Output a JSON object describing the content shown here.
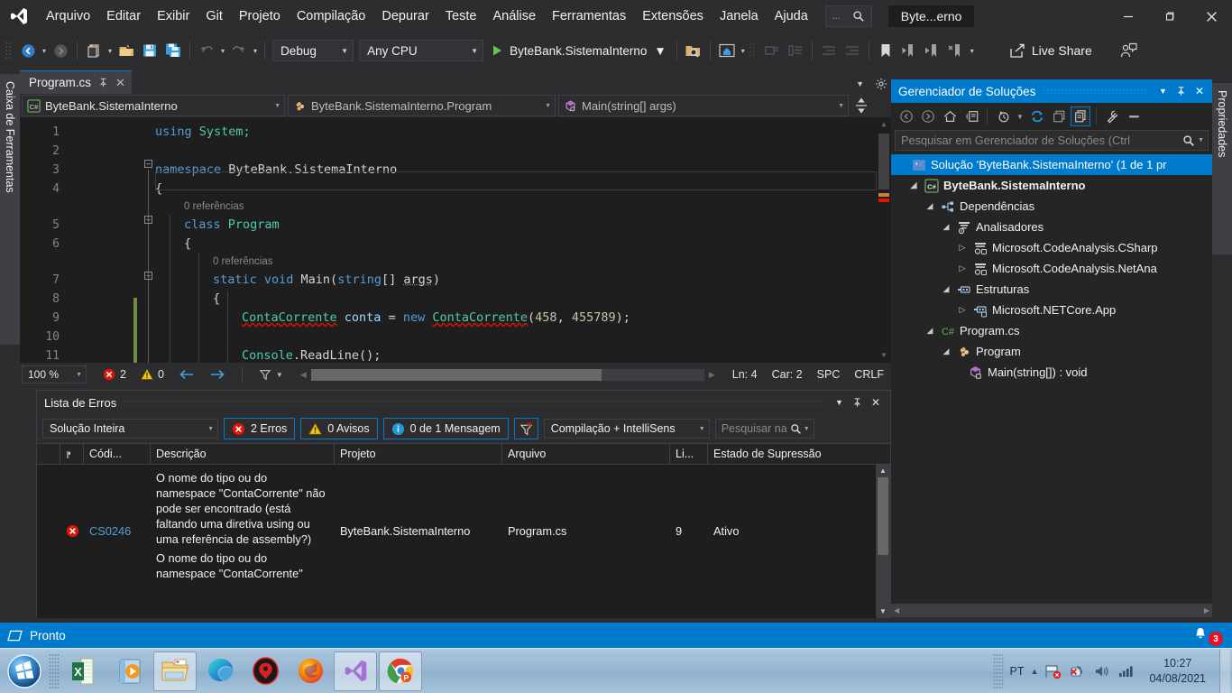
{
  "window": {
    "title": "Byte...erno",
    "app_icon": "visual-studio-logo",
    "controls": {
      "minimize": "—",
      "maximize": "❐",
      "close": "✕"
    }
  },
  "menubar": {
    "items": [
      "Arquivo",
      "Editar",
      "Exibir",
      "Git",
      "Projeto",
      "Compilação",
      "Depurar",
      "Teste",
      "Análise",
      "Ferramentas",
      "Extensões",
      "Janela",
      "Ajuda"
    ],
    "quick_launch": "..."
  },
  "toolbar": {
    "config_combo": "Debug",
    "platform_combo": "Any CPU",
    "run_label": "ByteBank.SistemaInterno",
    "live_share": "Live Share"
  },
  "docks": {
    "left_label": "Caixa de Ferramentas",
    "right_label": "Propriedades"
  },
  "editor": {
    "tab_title": "Program.cs",
    "nav": {
      "project": "ByteBank.SistemaInterno",
      "type": "ByteBank.SistemaInterno.Program",
      "member": "Main(string[] args)"
    },
    "line_numbers": [
      "1",
      "2",
      "3",
      "4",
      "5",
      "6",
      "7",
      "8",
      "9",
      "10",
      "11"
    ],
    "code_lines": [
      {
        "n": 1,
        "indent": 1,
        "tokens": [
          {
            "t": "using ",
            "c": "k"
          },
          {
            "t": "System;",
            "c": "t"
          }
        ]
      },
      {
        "n": 2,
        "indent": 0,
        "tokens": []
      },
      {
        "n": 3,
        "indent": 0,
        "tokens": [
          {
            "t": "namespace ",
            "c": "k"
          },
          {
            "t": "ByteBank.SistemaInterno",
            "c": "p"
          }
        ]
      },
      {
        "n": 4,
        "indent": 0,
        "tokens": [
          {
            "t": "{",
            "c": "p"
          }
        ]
      },
      {
        "n": 5,
        "indent": 2,
        "tokens": [
          {
            "t": "class ",
            "c": "k"
          },
          {
            "t": "Program",
            "c": "t"
          }
        ]
      },
      {
        "n": 6,
        "indent": 2,
        "tokens": [
          {
            "t": "{",
            "c": "p"
          }
        ]
      },
      {
        "n": 7,
        "indent": 3,
        "tokens": [
          {
            "t": "static ",
            "c": "k"
          },
          {
            "t": "void ",
            "c": "k"
          },
          {
            "t": "Main(",
            "c": "p"
          },
          {
            "t": "string",
            "c": "k"
          },
          {
            "t": "[] ",
            "c": "p"
          },
          {
            "t": "args",
            "c": "p"
          },
          {
            "t": ")",
            "c": "p"
          }
        ]
      },
      {
        "n": 8,
        "indent": 3,
        "tokens": [
          {
            "t": "{",
            "c": "p"
          }
        ]
      },
      {
        "n": 9,
        "indent": 4,
        "tokens": [
          {
            "t": "ContaCorrente",
            "c": "t squig"
          },
          {
            "t": " conta = ",
            "c": "p"
          },
          {
            "t": "new ",
            "c": "k"
          },
          {
            "t": "ContaCorrente",
            "c": "t squig"
          },
          {
            "t": "(",
            "c": "p"
          },
          {
            "t": "458",
            "c": "n"
          },
          {
            "t": ", ",
            "c": "p"
          },
          {
            "t": "455789",
            "c": "n"
          },
          {
            "t": ");",
            "c": "p"
          }
        ]
      },
      {
        "n": 10,
        "indent": 0,
        "tokens": []
      },
      {
        "n": 11,
        "indent": 4,
        "tokens": [
          {
            "t": "Console",
            "c": "t"
          },
          {
            "t": ".ReadLine();",
            "c": "p"
          }
        ]
      }
    ],
    "codelens": [
      {
        "text": "0 referências",
        "line": 5
      },
      {
        "text": "0 referências",
        "line": 7
      }
    ],
    "status": {
      "zoom": "100 %",
      "errors_count": "2",
      "warnings_count": "0",
      "line": "Ln: 4",
      "column": "Car: 2",
      "spaces": "SPC",
      "line_ending": "CRLF"
    }
  },
  "error_list": {
    "title": "Lista de Erros",
    "scope_combo": "Solução Inteira",
    "errors_button": "2 Erros",
    "warnings_button": "0 Avisos",
    "messages_button": "0 de 1 Mensagem",
    "build_combo": "Compilação + IntelliSens",
    "search_placeholder": "Pesquisar na",
    "columns": [
      "",
      "",
      "Códi...",
      "Descrição",
      "Projeto",
      "Arquivo",
      "Li...",
      "Estado de Supressão"
    ],
    "rows": [
      {
        "severity": "error",
        "code": "CS0246",
        "description": "O nome do tipo ou do namespace \"ContaCorrente\" não pode ser encontrado (está faltando uma diretiva using ou uma referência de assembly?)",
        "project": "ByteBank.SistemaInterno",
        "file": "Program.cs",
        "line": "9",
        "suppression": "Ativo"
      },
      {
        "severity": "error",
        "code": "",
        "description": "O nome do tipo ou do namespace \"ContaCorrente\"",
        "project": "",
        "file": "",
        "line": "",
        "suppression": ""
      }
    ]
  },
  "solution_explorer": {
    "title": "Gerenciador de Soluções",
    "search_placeholder": "Pesquisar em Gerenciador de Soluções (Ctrl",
    "tree": [
      {
        "label": "Solução 'ByteBank.SistemaInterno' (1 de 1 pr",
        "depth": 0,
        "icon": "solution-icon",
        "expander": "",
        "selected": true,
        "bold": false
      },
      {
        "label": "ByteBank.SistemaInterno",
        "depth": 1,
        "icon": "csharp-project-icon",
        "expander": "expanded",
        "selected": false,
        "bold": true
      },
      {
        "label": "Dependências",
        "depth": 2,
        "icon": "dependencies-icon",
        "expander": "expanded",
        "selected": false,
        "bold": false
      },
      {
        "label": "Analisadores",
        "depth": 3,
        "icon": "analyzers-icon",
        "expander": "expanded",
        "selected": false,
        "bold": false
      },
      {
        "label": "Microsoft.CodeAnalysis.CSharp",
        "depth": 4,
        "icon": "analyzer-icon",
        "expander": "collapsed",
        "selected": false,
        "bold": false
      },
      {
        "label": "Microsoft.CodeAnalysis.NetAna",
        "depth": 4,
        "icon": "analyzer-icon",
        "expander": "collapsed",
        "selected": false,
        "bold": false
      },
      {
        "label": "Estruturas",
        "depth": 3,
        "icon": "framework-icon",
        "expander": "expanded",
        "selected": false,
        "bold": false
      },
      {
        "label": "Microsoft.NETCore.App",
        "depth": 4,
        "icon": "framework-icon",
        "expander": "collapsed",
        "selected": false,
        "bold": false
      },
      {
        "label": "Program.cs",
        "depth": 2,
        "icon": "csharp-file-icon",
        "expander": "expanded",
        "selected": false,
        "bold": false
      },
      {
        "label": "Program",
        "depth": 3,
        "icon": "class-icon",
        "expander": "expanded",
        "selected": false,
        "bold": false
      },
      {
        "label": "Main(string[]) : void",
        "depth": 4,
        "icon": "method-icon",
        "expander": "",
        "selected": false,
        "bold": false
      }
    ]
  },
  "vs_status_bar": {
    "text": "Pronto",
    "notification_count": "3"
  },
  "taskbar": {
    "start": "windows-orb",
    "apps": [
      {
        "name": "excel-icon",
        "pressed": false
      },
      {
        "name": "media-player-icon",
        "pressed": false
      },
      {
        "name": "file-explorer-icon",
        "pressed": true
      },
      {
        "name": "microsoft-edge-icon",
        "pressed": false
      },
      {
        "name": "gamemaker-icon",
        "pressed": false
      },
      {
        "name": "firefox-icon",
        "pressed": false
      },
      {
        "name": "visual-studio-icon",
        "pressed": true
      },
      {
        "name": "chrome-icon",
        "pressed": true
      }
    ],
    "tray": {
      "language": "PT",
      "time": "10:27",
      "date": "04/08/2021"
    }
  },
  "colors": {
    "accent": "#007acc",
    "titlebar_bg": "#2d2d30",
    "editor_bg": "#1e1e1e",
    "error_red": "#e81123",
    "keyword_blue": "#569cd6",
    "type_teal": "#4ec9b0",
    "number_green": "#b5cea8"
  }
}
